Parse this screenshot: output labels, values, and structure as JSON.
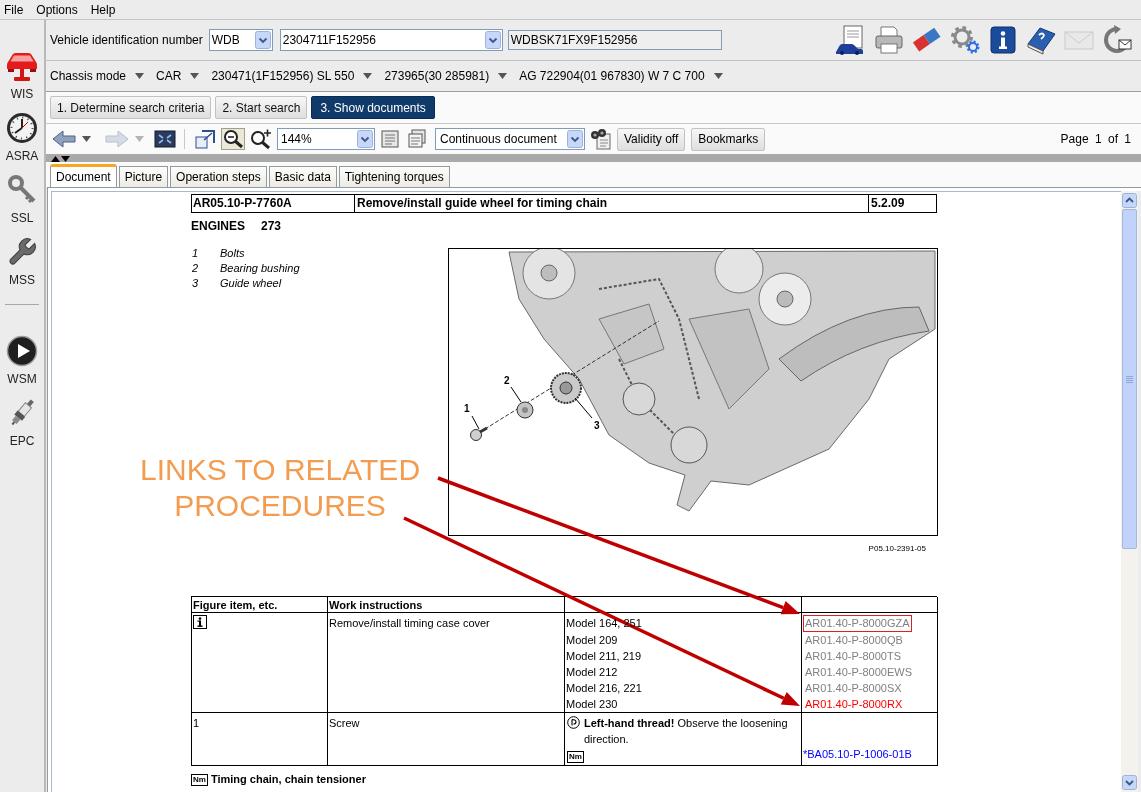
{
  "menu": [
    {
      "label": "File"
    },
    {
      "label": "Options"
    },
    {
      "label": "Help"
    }
  ],
  "sidebar": {
    "groups": [
      [
        {
          "kind": "car",
          "label": "WIS"
        },
        {
          "kind": "clock",
          "label": "ASRA"
        },
        {
          "kind": "key",
          "label": "SSL"
        },
        {
          "kind": "wrench",
          "label": "MSS"
        }
      ],
      [
        {
          "kind": "play",
          "label": "WSM"
        },
        {
          "kind": "plug",
          "label": "EPC"
        }
      ]
    ]
  },
  "vehicle": {
    "label": "Vehicle identification number",
    "prefix": "WDB",
    "number": "2304711F152956",
    "vin": "WDBSK71FX9F152956"
  },
  "tools": [
    {
      "kind": "vehicle-document",
      "disabled": false
    },
    {
      "kind": "printer",
      "disabled": false
    },
    {
      "kind": "eraser",
      "disabled": false
    },
    {
      "kind": "settings",
      "disabled": false
    },
    {
      "kind": "info",
      "disabled": false
    },
    {
      "kind": "help",
      "disabled": false
    },
    {
      "kind": "mail",
      "disabled": true
    },
    {
      "kind": "sync-mail",
      "disabled": false
    }
  ],
  "chassis": [
    {
      "label": "Chassis mode"
    },
    {
      "label": "CAR"
    },
    {
      "label": "230471(1F152956) SL 550"
    },
    {
      "label": "273965(30 285981)"
    },
    {
      "label": "AG 722904(01 967830) W 7 C 700"
    }
  ],
  "steps": [
    {
      "label": "1. Determine search criteria",
      "selected": false
    },
    {
      "label": "2. Start search",
      "selected": false
    },
    {
      "label": "3. Show documents",
      "selected": true
    }
  ],
  "doc_toolbar": {
    "nav": [
      {
        "kind": "back",
        "disabled": false
      },
      {
        "kind": "forward",
        "disabled": true
      }
    ],
    "view_tools": [
      {
        "kind": "select-area",
        "selected": false
      },
      {
        "kind": "zoom-out",
        "selected": true
      },
      {
        "kind": "zoom-in",
        "selected": false
      }
    ],
    "zoom": "144%",
    "layout": "Continuous document",
    "buttons": [
      {
        "label": "Validity off"
      },
      {
        "label": "Bookmarks"
      }
    ],
    "page": "Page 1 of 1"
  },
  "tabs": [
    {
      "label": "Document",
      "selected": true
    },
    {
      "label": "Picture",
      "selected": false
    },
    {
      "label": "Operation steps",
      "selected": false
    },
    {
      "label": "Basic data",
      "selected": false
    },
    {
      "label": "Tightening torques",
      "selected": false
    }
  ],
  "document": {
    "header": {
      "code": "AR05.10-P-7760A",
      "title": "Remove/install guide wheel for timing chain",
      "date": "5.2.09"
    },
    "engines": {
      "label": "ENGINES",
      "value": "273"
    },
    "legend": [
      {
        "number": "1",
        "text": "Bolts"
      },
      {
        "number": "2",
        "text": "Bearing bushing"
      },
      {
        "number": "3",
        "text": "Guide wheel"
      }
    ],
    "figure": {
      "callouts": [
        "1",
        "2",
        "3"
      ],
      "caption": "P05.10-2391-05"
    },
    "table": {
      "columns": [
        "Figure item, etc.",
        "Work instructions"
      ],
      "rows": [
        {
          "kind": "models",
          "info_icon": true,
          "instruction": "Remove/install timing case cover",
          "entries": [
            {
              "model": "Model 164, 251",
              "link": "AR01.40-P-8000GZA",
              "color": "#808080",
              "boxed": true
            },
            {
              "model": "Model 209",
              "link": "AR01.40-P-8000QB",
              "color": "#808080",
              "boxed": false
            },
            {
              "model": "Model 211, 219",
              "link": "AR01.40-P-8000TS",
              "color": "#808080",
              "boxed": false
            },
            {
              "model": "Model 212",
              "link": "AR01.40-P-8000EWS",
              "color": "#808080",
              "boxed": false
            },
            {
              "model": "Model 216, 221",
              "link": "AR01.40-P-8000SX",
              "color": "#808080",
              "boxed": false
            },
            {
              "model": "Model 230",
              "link": "AR01.40-P-8000RX",
              "color": "#ff0000",
              "boxed": false
            }
          ]
        },
        {
          "kind": "note",
          "info_icon": false,
          "item": "1",
          "instruction": "Screw",
          "note": "**Left-hand thread!** Observe the loosening direction.",
          "symbol": "Nm",
          "link": "*BA05.10-P-1006-01B",
          "color": "#0000ff"
        }
      ]
    },
    "section": {
      "symbol": "Nm",
      "title": "Timing chain, chain tensioner"
    }
  },
  "annotation": {
    "text": "LINKS TO RELATED PROCEDURES"
  }
}
